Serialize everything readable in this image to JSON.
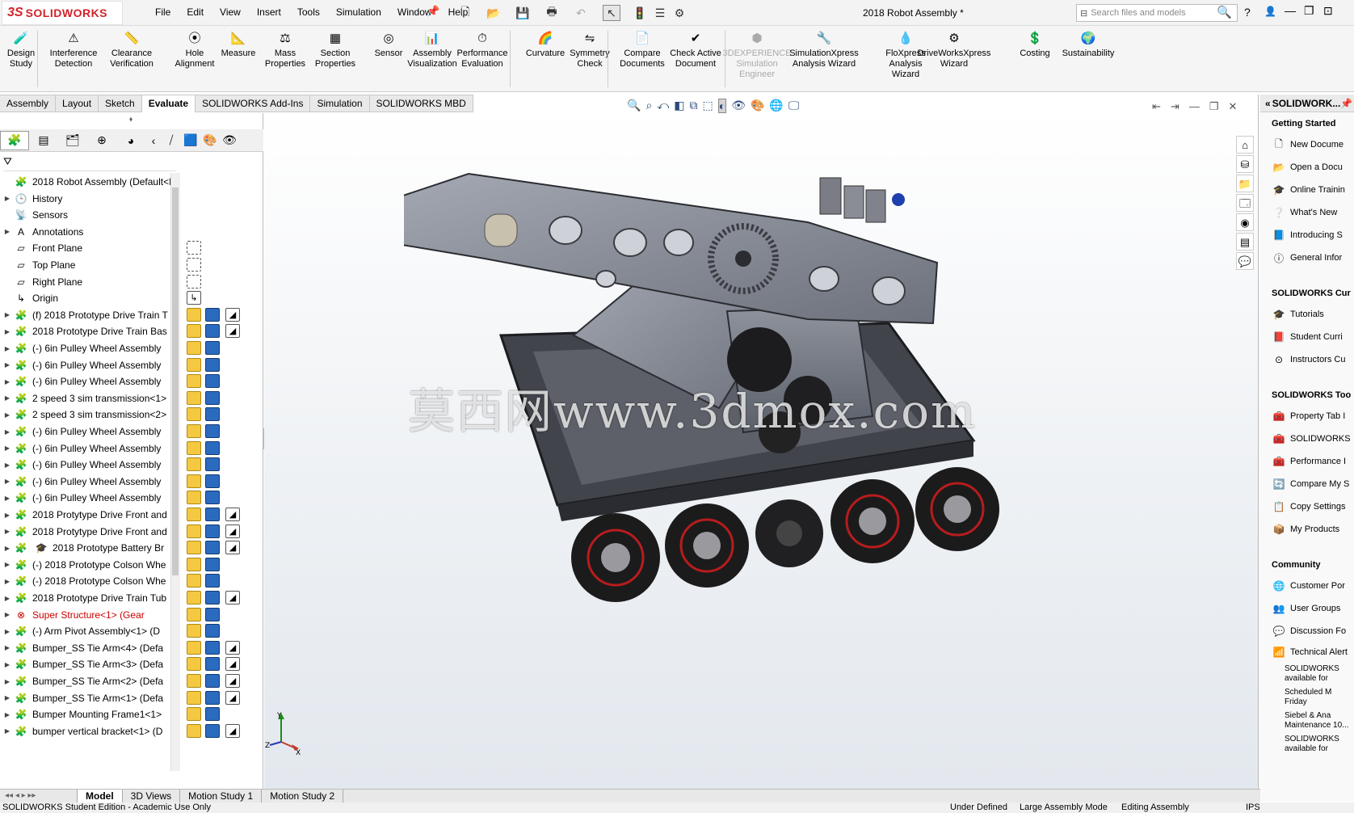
{
  "app": {
    "title": "2018 Robot  Assembly *",
    "logo": "SOLIDWORKS",
    "logo_ds": "3S"
  },
  "menu": [
    "File",
    "Edit",
    "View",
    "Insert",
    "Tools",
    "Simulation",
    "Window",
    "Help"
  ],
  "search": {
    "placeholder": "Search files and models"
  },
  "ribbon": [
    {
      "label": "Design\nStudy",
      "icon": "design-study-icon"
    },
    {
      "label": "Interference\nDetection",
      "icon": "interference-icon"
    },
    {
      "label": "Clearance\nVerification",
      "icon": "clearance-icon"
    },
    {
      "label": "Hole\nAlignment",
      "icon": "hole-icon"
    },
    {
      "label": "Measure",
      "icon": "measure-icon"
    },
    {
      "label": "Mass\nProperties",
      "icon": "mass-icon"
    },
    {
      "label": "Section\nProperties",
      "icon": "section-icon"
    },
    {
      "label": "Sensor",
      "icon": "sensor-icon"
    },
    {
      "label": "Assembly\nVisualization",
      "icon": "visualization-icon"
    },
    {
      "label": "Performance\nEvaluation",
      "icon": "performance-icon"
    },
    {
      "label": "Curvature",
      "icon": "curvature-icon"
    },
    {
      "label": "Symmetry\nCheck",
      "icon": "symmetry-icon"
    },
    {
      "label": "Compare\nDocuments",
      "icon": "compare-icon"
    },
    {
      "label": "Check Active\nDocument",
      "icon": "check-icon"
    },
    {
      "label": "3DEXPERIENCE\nSimulation\nEngineer",
      "icon": "3dx-icon",
      "disabled": true
    },
    {
      "label": "SimulationXpress\nAnalysis Wizard",
      "icon": "simxpress-icon"
    },
    {
      "label": "FloXpress\nAnalysis\nWizard",
      "icon": "floxpress-icon"
    },
    {
      "label": "DriveWorksXpress\nWizard",
      "icon": "driveworks-icon"
    },
    {
      "label": "Costing",
      "icon": "costing-icon"
    },
    {
      "label": "Sustainability",
      "icon": "sustainability-icon"
    }
  ],
  "tabs": [
    "Assembly",
    "Layout",
    "Sketch",
    "Evaluate",
    "SOLIDWORKS Add-Ins",
    "Simulation",
    "SOLIDWORKS MBD"
  ],
  "active_tab": "Evaluate",
  "tree": [
    {
      "label": "2018 Robot  Assembly  (Default<Di",
      "icon": "assembly-icon",
      "arrow": ""
    },
    {
      "label": "History",
      "icon": "history-icon",
      "arrow": "▶"
    },
    {
      "label": "Sensors",
      "icon": "sensor-icon",
      "arrow": ""
    },
    {
      "label": "Annotations",
      "icon": "annotations-icon",
      "arrow": "▶"
    },
    {
      "label": "Front Plane",
      "icon": "plane-icon",
      "arrow": ""
    },
    {
      "label": "Top Plane",
      "icon": "plane-icon",
      "arrow": ""
    },
    {
      "label": "Right Plane",
      "icon": "plane-icon",
      "arrow": ""
    },
    {
      "label": "Origin",
      "icon": "origin-icon",
      "arrow": ""
    },
    {
      "label": "(f) 2018 Prototype Drive Train T",
      "icon": "subassembly-icon",
      "arrow": "▶"
    },
    {
      "label": "2018 Prototype Drive Train Bas",
      "icon": "subassembly-icon",
      "arrow": "▶"
    },
    {
      "label": "(-) 6in Pulley Wheel Assembly",
      "icon": "subassembly-icon",
      "arrow": "▶"
    },
    {
      "label": "(-) 6in Pulley Wheel Assembly",
      "icon": "subassembly-icon",
      "arrow": "▶"
    },
    {
      "label": "(-) 6in Pulley Wheel Assembly",
      "icon": "subassembly-icon",
      "arrow": "▶"
    },
    {
      "label": "2 speed 3 sim transmission<1>",
      "icon": "subassembly-icon",
      "arrow": "▶"
    },
    {
      "label": "2 speed 3 sim transmission<2>",
      "icon": "subassembly-icon",
      "arrow": "▶"
    },
    {
      "label": "(-) 6in Pulley Wheel Assembly",
      "icon": "subassembly-icon",
      "arrow": "▶"
    },
    {
      "label": "(-) 6in Pulley Wheel Assembly",
      "icon": "subassembly-icon",
      "arrow": "▶"
    },
    {
      "label": "(-) 6in Pulley Wheel Assembly",
      "icon": "subassembly-icon",
      "arrow": "▶"
    },
    {
      "label": "(-) 6in Pulley Wheel Assembly",
      "icon": "subassembly-icon",
      "arrow": "▶"
    },
    {
      "label": "(-) 6in Pulley Wheel Assembly",
      "icon": "subassembly-icon",
      "arrow": "▶"
    },
    {
      "label": "2018 Protytype Drive Front and",
      "icon": "subassembly-icon",
      "arrow": "▶"
    },
    {
      "label": "2018 Protytype Drive Front and",
      "icon": "subassembly-icon",
      "arrow": "▶"
    },
    {
      "label": "2018 Prototype Battery Br",
      "icon": "subassembly-icon",
      "arrow": "▶",
      "extra": "cap-icon"
    },
    {
      "label": "(-) 2018 Prototype Colson Whe",
      "icon": "subassembly-icon",
      "arrow": "▶"
    },
    {
      "label": "(-) 2018 Prototype Colson Whe",
      "icon": "subassembly-icon",
      "arrow": "▶"
    },
    {
      "label": "2018 Prototype Drive Train Tub",
      "icon": "subassembly-icon",
      "arrow": "▶"
    },
    {
      "label": "Super Structure<1> (Gear",
      "icon": "subassembly-icon",
      "arrow": "▶",
      "error": true
    },
    {
      "label": "(-) Arm Pivot Assembly<1> (D",
      "icon": "subassembly-icon",
      "arrow": "▶"
    },
    {
      "label": "Bumper_SS Tie Arm<4> (Defa",
      "icon": "subassembly-icon",
      "arrow": "▶"
    },
    {
      "label": "Bumper_SS Tie Arm<3> (Defa",
      "icon": "subassembly-icon",
      "arrow": "▶"
    },
    {
      "label": "Bumper_SS Tie Arm<2> (Defa",
      "icon": "subassembly-icon",
      "arrow": "▶"
    },
    {
      "label": "Bumper_SS Tie Arm<1> (Defa",
      "icon": "subassembly-icon",
      "arrow": "▶"
    },
    {
      "label": "Bumper Mounting Frame1<1>",
      "icon": "subassembly-icon",
      "arrow": "▶"
    },
    {
      "label": "bumper vertical bracket<1> (D",
      "icon": "subassembly-icon",
      "arrow": "▶"
    }
  ],
  "bottom_tabs": [
    "Model",
    "3D Views",
    "Motion Study 1",
    "Motion Study 2"
  ],
  "active_bottom": "Model",
  "status": {
    "left": "SOLIDWORKS Student Edition - Academic Use Only",
    "s1": "Under Defined",
    "s2": "Large Assembly Mode",
    "s3": "Editing Assembly",
    "units": "IPS"
  },
  "watermark": "莫西网www.3dmox.com",
  "taskpane": {
    "header": "SOLIDWORK...",
    "sections": [
      {
        "title": "Getting Started",
        "items": [
          {
            "label": "New Docume",
            "icon": "new-doc-icon"
          },
          {
            "label": "Open a Docu",
            "icon": "open-doc-icon"
          },
          {
            "label": "Online Trainin",
            "icon": "training-icon"
          },
          {
            "label": "What's New",
            "icon": "whats-new-icon"
          },
          {
            "label": "Introducing S",
            "icon": "intro-icon"
          },
          {
            "label": "General Infor",
            "icon": "info-icon"
          }
        ]
      },
      {
        "title": "SOLIDWORKS Cur",
        "items": [
          {
            "label": "Tutorials",
            "icon": "tutorials-icon"
          },
          {
            "label": "Student Curri",
            "icon": "curriculum-icon"
          },
          {
            "label": "Instructors Cu",
            "icon": "instructors-icon"
          }
        ]
      },
      {
        "title": "SOLIDWORKS Too",
        "items": [
          {
            "label": "Property Tab I",
            "icon": "tool-icon"
          },
          {
            "label": "SOLIDWORKS",
            "icon": "tool-icon"
          },
          {
            "label": "Performance I",
            "icon": "tool-icon"
          },
          {
            "label": "Compare My S",
            "icon": "compare-icon"
          },
          {
            "label": "Copy Settings",
            "icon": "copy-icon"
          },
          {
            "label": "My Products",
            "icon": "products-icon"
          }
        ]
      },
      {
        "title": "Community",
        "items": [
          {
            "label": "Customer Por",
            "icon": "portal-icon"
          },
          {
            "label": "User Groups",
            "icon": "groups-icon"
          },
          {
            "label": "Discussion Fo",
            "icon": "forum-icon"
          }
        ]
      }
    ],
    "tech_alerts": "Technical Alert",
    "news": [
      "SOLIDWORKS available for",
      "Scheduled M Friday",
      "Siebel & Ana Maintenance 10...",
      "SOLIDWORKS available for"
    ]
  }
}
